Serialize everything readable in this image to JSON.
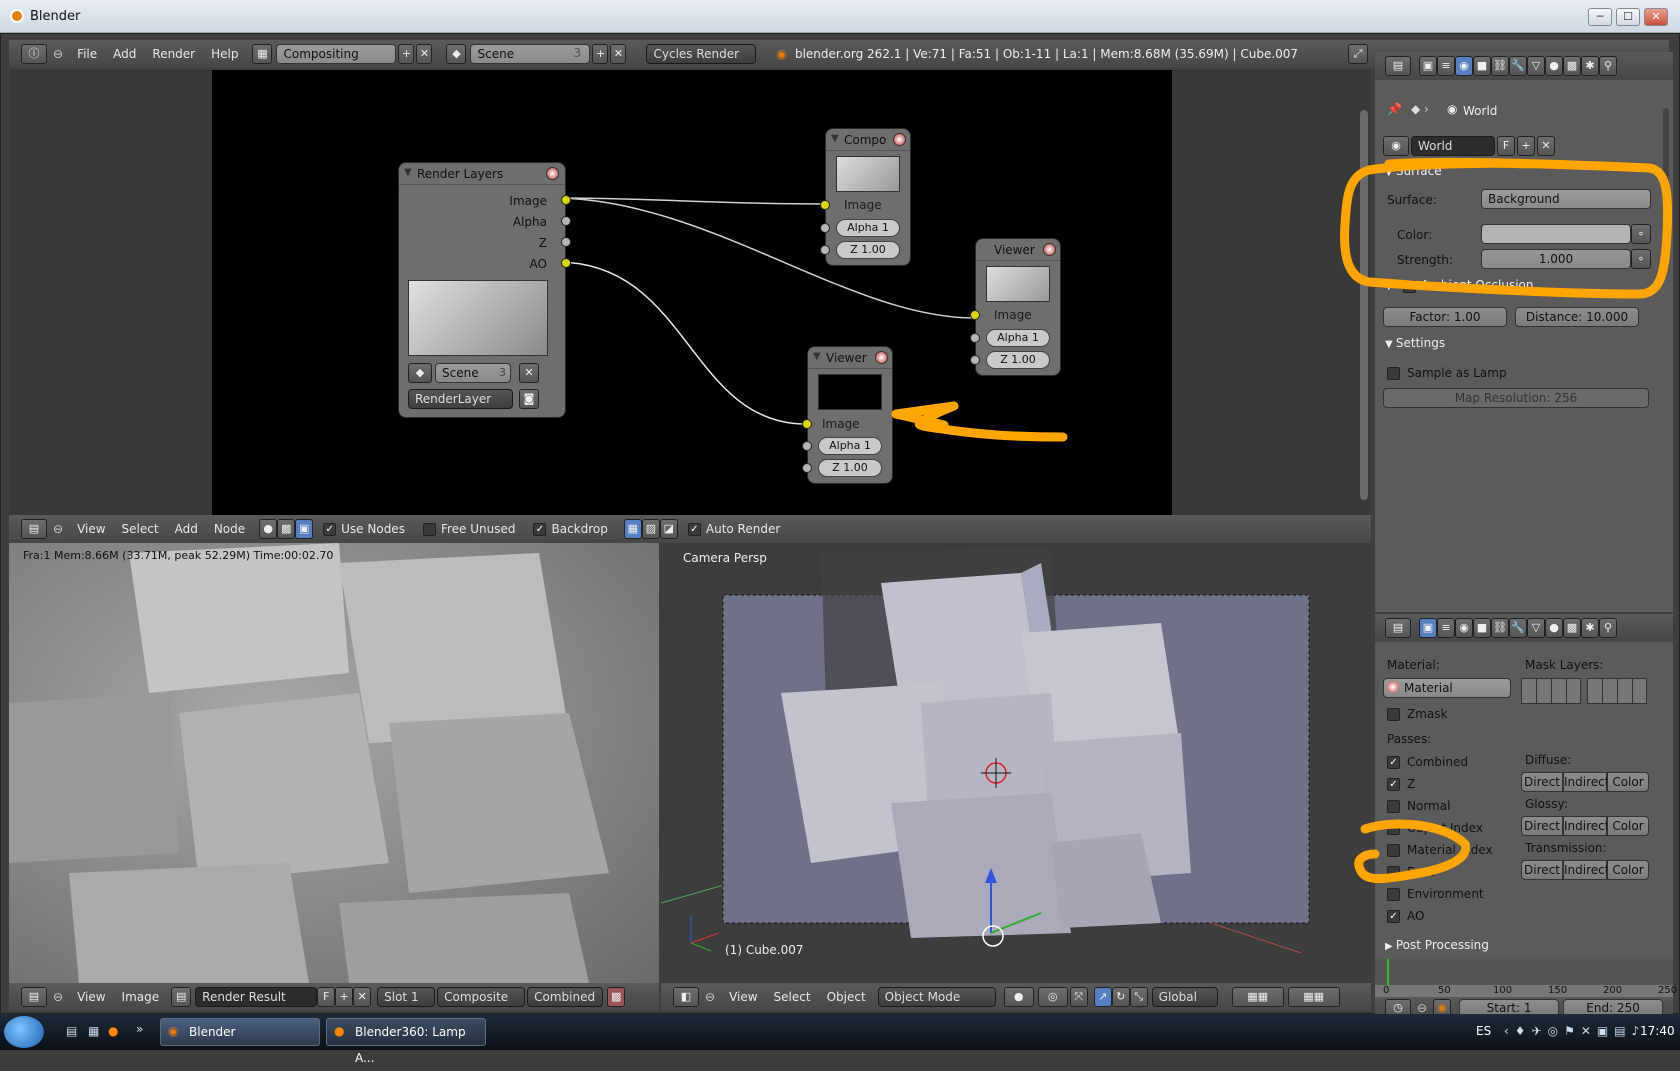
{
  "window": {
    "title": "Blender",
    "min": "─",
    "max": "☐",
    "close": "✕"
  },
  "topbar": {
    "menus": [
      "File",
      "Add",
      "Render",
      "Help"
    ],
    "screen": "Compositing",
    "scene": "Scene",
    "scene_users": "3",
    "engine": "Cycles Render",
    "stats": "blender.org 262.1 | Ve:71 | Fa:51 | Ob:1-11 | La:1 | Mem:8.68M (35.69M) | Cube.007"
  },
  "nodes": {
    "render_layers": {
      "title": "Render Layers",
      "outputs": [
        "Image",
        "Alpha",
        "Z",
        "AO"
      ],
      "scene": "Scene",
      "scene_users": "3",
      "layer": "RenderLayer"
    },
    "composite": {
      "title": "Compo",
      "input": "Image",
      "alpha": "Alpha 1",
      "z": "Z 1.00"
    },
    "viewer1": {
      "title": "Viewer",
      "input": "Image",
      "alpha": "Alpha 1",
      "z": "Z 1.00"
    },
    "viewer2": {
      "title": "Viewer",
      "input": "Image",
      "alpha": "Alpha 1",
      "z": "Z 1.00"
    }
  },
  "node_header": {
    "menus": [
      "View",
      "Select",
      "Add",
      "Node"
    ],
    "use_nodes": "Use Nodes",
    "free_unused": "Free Unused",
    "backdrop": "Backdrop",
    "auto_render": "Auto Render"
  },
  "image_editor": {
    "info": "Fra:1  Mem:8.66M (33.71M, peak 52.29M) Time:00:02.70",
    "menus": [
      "View",
      "Image"
    ],
    "image": "Render Result",
    "fake": "F",
    "slot": "Slot 1",
    "composite": "Composite",
    "pass": "Combined"
  },
  "viewport": {
    "label": "Camera Persp",
    "object": "(1) Cube.007",
    "menus": [
      "View",
      "Select",
      "Object"
    ],
    "mode": "Object Mode",
    "orientation": "Global"
  },
  "world_panel": {
    "breadcrumb": "World",
    "world_name": "World",
    "fake": "F",
    "surface_section": "Surface",
    "surface_label": "Surface:",
    "surface_value": "Background",
    "color_label": "Color:",
    "strength_label": "Strength:",
    "strength_value": "1.000",
    "ao_section": "Ambient Occlusion",
    "ao_factor": "Factor: 1.00",
    "ao_distance": "Distance: 10.000",
    "settings_section": "Settings",
    "sample_as_lamp": "Sample as Lamp",
    "map_resolution": "Map Resolution: 256"
  },
  "render_panel": {
    "material_label": "Material:",
    "mask_layers_label": "Mask Layers:",
    "material_value": "Material",
    "zmask": "Zmask",
    "passes_label": "Passes:",
    "passes": [
      {
        "name": "Combined",
        "checked": true
      },
      {
        "name": "Z",
        "checked": true
      },
      {
        "name": "Normal",
        "checked": false
      },
      {
        "name": "Object Index",
        "checked": false
      },
      {
        "name": "Material Index",
        "checked": false
      },
      {
        "name": "Emit",
        "checked": false
      },
      {
        "name": "Environment",
        "checked": false
      },
      {
        "name": "AO",
        "checked": true
      }
    ],
    "diffuse_label": "Diffuse:",
    "glossy_label": "Glossy:",
    "transmission_label": "Transmission:",
    "direct": "Direct",
    "indirect": "Indirect",
    "color": "Color",
    "post_processing": "Post Processing"
  },
  "timeline": {
    "ticks": [
      "0",
      "50",
      "100",
      "150",
      "200",
      "250"
    ],
    "start": "Start: 1",
    "end": "End: 250"
  },
  "taskbar": {
    "items": [
      "Blender",
      "Blender360: Lamp A..."
    ],
    "lang": "ES",
    "clock": "17:40"
  }
}
